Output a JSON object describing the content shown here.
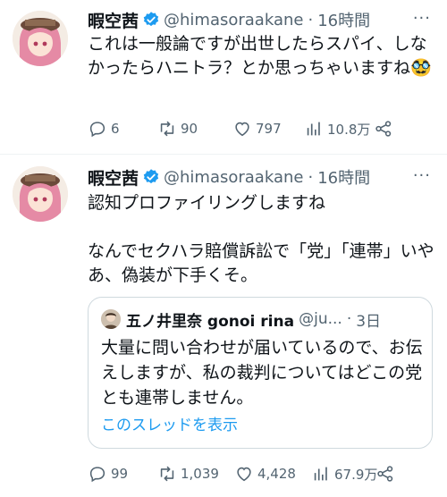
{
  "tweets": [
    {
      "display_name": "暇空茜",
      "handle": "@himasoraakane",
      "separator": "·",
      "time": "16時間",
      "more": "···",
      "text": "これは一般論ですが出世したらスパイ、しなかったらハニトラ？とか思っちゃいますね",
      "emoji": "🥸",
      "replies": "6",
      "retweets": "90",
      "likes": "797",
      "views": "10.8万"
    },
    {
      "display_name": "暇空茜",
      "handle": "@himasoraakane",
      "separator": "·",
      "time": "16時間",
      "more": "···",
      "text": "認知プロファイリングしますね\n\nなんでセクハラ賠償訴訟で「党」「連帯」いやあ、偽装が下手くそ。",
      "quote": {
        "display_name": "五ノ井里奈 gonoi rina",
        "handle": "@ju...",
        "separator": "·",
        "time": "3日",
        "text": "大量に問い合わせが届いているので、お伝えしますが、私の裁判についてはどこの党とも連帯しません。",
        "show_thread": "このスレッドを表示"
      },
      "replies": "99",
      "retweets": "1,039",
      "likes": "4,428",
      "views": "67.9万"
    }
  ],
  "colors": {
    "verified": "#1d9bf0",
    "link": "#1d9bf0",
    "muted": "#536471"
  }
}
